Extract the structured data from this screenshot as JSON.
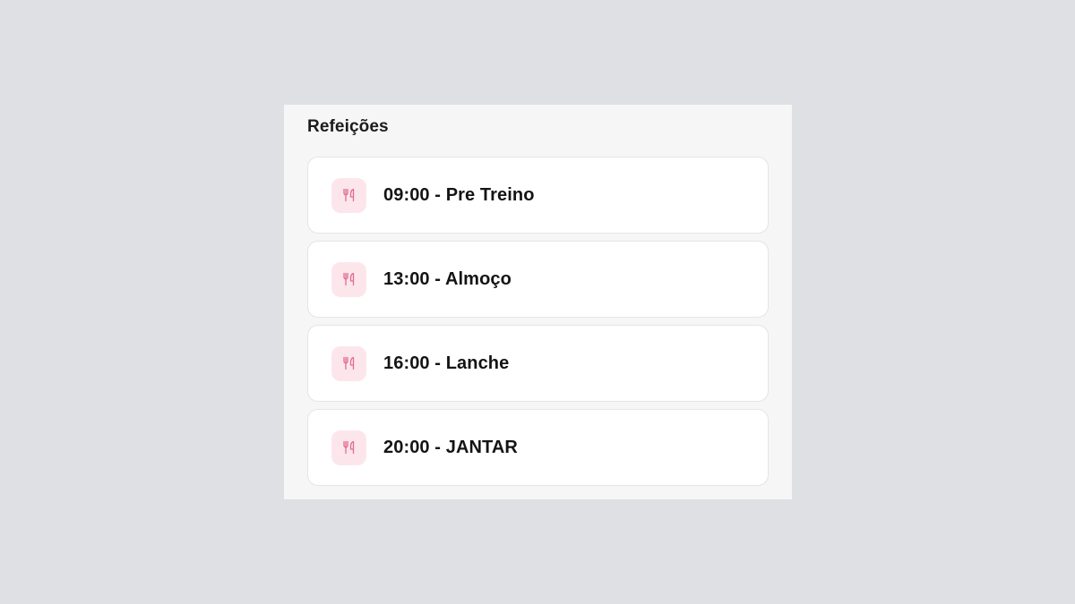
{
  "section": {
    "title": "Refeições"
  },
  "meals": [
    {
      "label": "09:00 - Pre Treino",
      "icon": "utensils-icon"
    },
    {
      "label": "13:00 - Almoço",
      "icon": "utensils-icon"
    },
    {
      "label": "16:00 - Lanche",
      "icon": "utensils-icon"
    },
    {
      "label": "20:00 - JANTAR",
      "icon": "utensils-icon"
    }
  ],
  "colors": {
    "page_background": "#dee0e4",
    "panel_background": "#f5f6f5",
    "card_background": "#ffffff",
    "icon_background": "#fce6ec",
    "icon_color": "#e06b95",
    "text": "#141414"
  }
}
